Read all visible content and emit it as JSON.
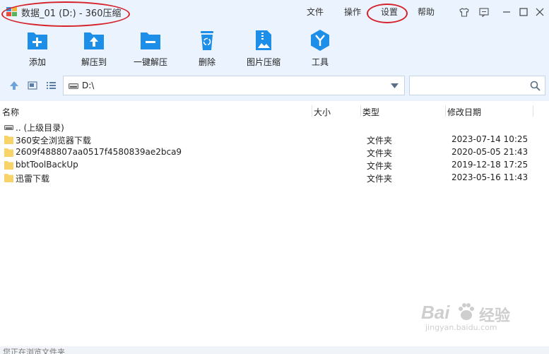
{
  "window": {
    "title": "数据_01 (D:) - 360压缩",
    "menu": [
      "文件",
      "操作",
      "设置",
      "帮助"
    ]
  },
  "toolbar": {
    "items": [
      {
        "label": "添加",
        "icon": "add-icon"
      },
      {
        "label": "解压到",
        "icon": "extract-to-icon"
      },
      {
        "label": "一键解压",
        "icon": "one-click-extract-icon"
      },
      {
        "label": "删除",
        "icon": "delete-icon"
      },
      {
        "label": "图片压缩",
        "icon": "image-compress-icon"
      },
      {
        "label": "工具",
        "icon": "tools-icon"
      }
    ]
  },
  "address": {
    "path": "D:\\"
  },
  "columns": {
    "name": "名称",
    "size": "大小",
    "type": "类型",
    "modified": "修改日期"
  },
  "parent_row": {
    "label": ".. (上级目录)"
  },
  "files": [
    {
      "name": "360安全浏览器下载",
      "type": "文件夹",
      "modified": "2023-07-14 10:25"
    },
    {
      "name": "2609f488807aa0517f4580839ae2bca9",
      "type": "文件夹",
      "modified": "2020-05-05 21:43"
    },
    {
      "name": "bbtToolBackUp",
      "type": "文件夹",
      "modified": "2019-12-18 17:25"
    },
    {
      "name": "迅雷下载",
      "type": "文件夹",
      "modified": "2023-05-16 11:43"
    }
  ],
  "status": {
    "text": "您正在浏览文件夹"
  },
  "watermark": {
    "brand": "Bai",
    "brand_suffix": "经验",
    "url": "jingyan.baidu.com"
  },
  "colors": {
    "accent": "#1e8fe8",
    "toolbar_bg": "#eaf3fe",
    "folder": "#f7d36a",
    "annotation": "#d6222a"
  }
}
